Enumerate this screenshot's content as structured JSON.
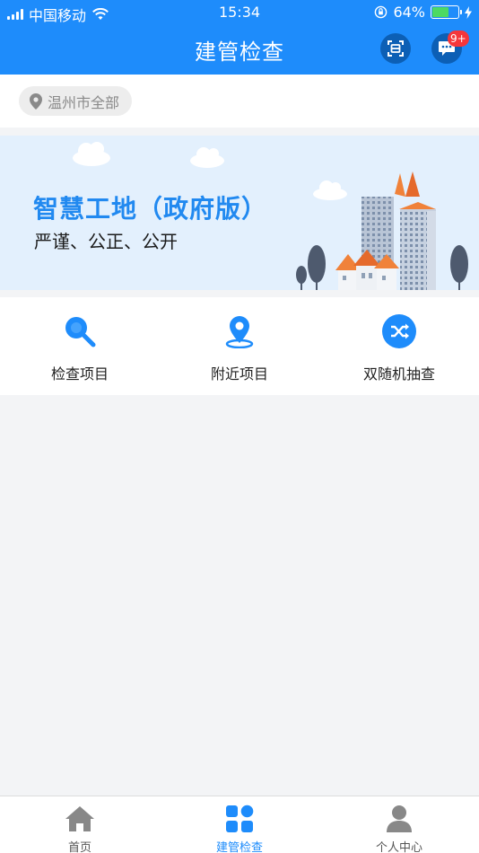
{
  "status_bar": {
    "carrier": "中国移动",
    "time": "15:34",
    "battery": "64%",
    "battery_level": 0.64
  },
  "nav": {
    "title": "建管检查",
    "message_badge": "9+"
  },
  "location": {
    "label": "温州市全部"
  },
  "banner": {
    "title": "智慧工地（政府版）",
    "subtitle": "严谨、公正、公开"
  },
  "actions": [
    {
      "label": "检查项目",
      "icon": "search-icon"
    },
    {
      "label": "附近项目",
      "icon": "location-pin-icon"
    },
    {
      "label": "双随机抽查",
      "icon": "shuffle-icon"
    }
  ],
  "tabs": [
    {
      "label": "首页",
      "icon": "home-icon",
      "active": false
    },
    {
      "label": "建管检查",
      "icon": "grid-icon",
      "active": true
    },
    {
      "label": "个人中心",
      "icon": "user-icon",
      "active": false
    }
  ],
  "colors": {
    "primary": "#1e8cfb",
    "nav_button": "#0c5fb5",
    "badge": "#f5363b",
    "battery_fill": "#4cd964"
  }
}
